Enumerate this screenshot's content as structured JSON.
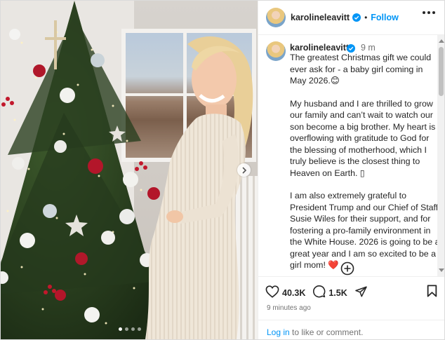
{
  "post": {
    "username": "karolineleavitt",
    "follow_label": "Follow",
    "bullet": "•",
    "time_short": "9 m",
    "time_ago": "9 minutes ago",
    "caption": [
      "The greatest Christmas gift we could ever ask for - a baby girl coming in May 2026.😊",
      "My husband and I are thrilled to grow our family and can’t wait to watch our son become a big brother. My heart is overflowing with gratitude to God for the blessing of motherhood, which I truly believe is the closest thing to Heaven on Earth. ▯",
      "I am also extremely grateful to President Trump and our Chief of Staff Susie Wiles for their support, and for fostering a pro-family environment in the White House. 2026 is going to be a great year and I am so excited to be a girl mom! ❤️"
    ],
    "likes": "40.3K",
    "comments": "1.5K",
    "carousel": {
      "count": 4,
      "active": 1
    }
  },
  "footer": {
    "login_link": "Log in",
    "login_text": " to like or comment."
  },
  "colors": {
    "accent": "#0095f6",
    "verified": "#0095f6",
    "text": "#262626",
    "muted": "#737373",
    "heart_emoji": "#e0245e"
  },
  "icons": [
    "verified-badge-icon",
    "more-options-icon",
    "heart-icon",
    "comment-icon",
    "share-icon",
    "bookmark-icon",
    "add-comment-icon",
    "chevron-right-icon"
  ]
}
